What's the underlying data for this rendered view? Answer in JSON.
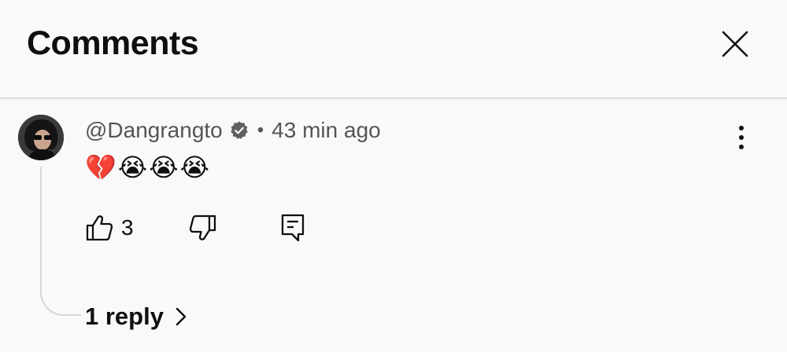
{
  "header": {
    "title": "Comments"
  },
  "comment": {
    "author": "@Dangrangto",
    "verified": true,
    "separator": "•",
    "timestamp": "43 min ago",
    "text": "💔😭😭😭",
    "like_count": "3",
    "replies_label": "1 reply"
  },
  "icons": {
    "close": "close-icon",
    "verified": "verified-badge-icon",
    "more": "more-vertical-icon",
    "like": "thumbs-up-icon",
    "dislike": "thumbs-down-icon",
    "reply": "reply-comment-icon",
    "chevron": "chevron-right-icon"
  }
}
